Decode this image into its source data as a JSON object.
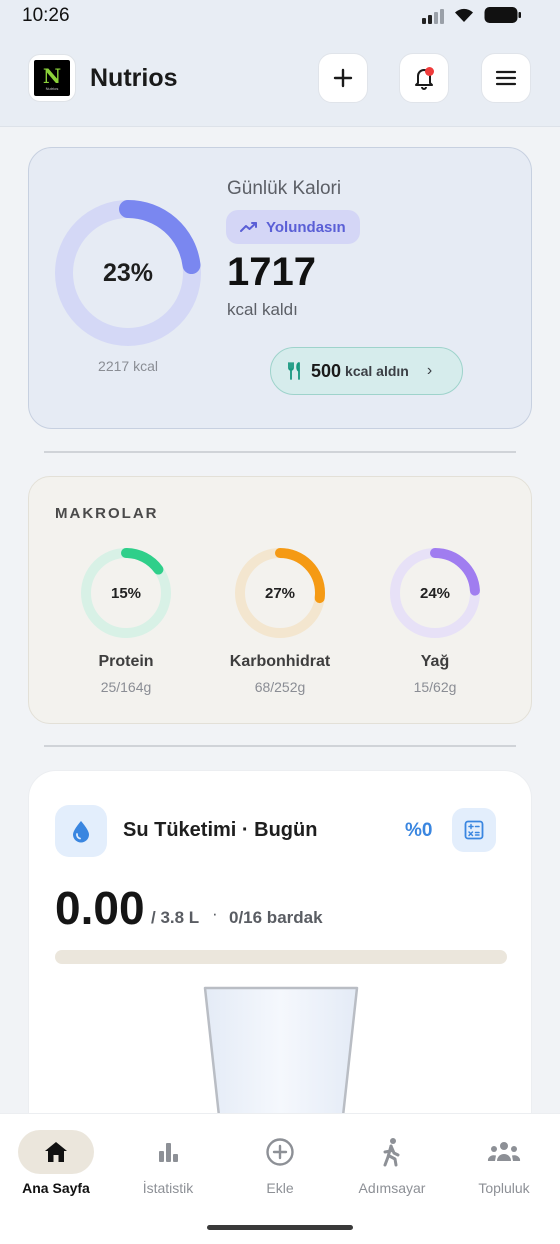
{
  "status_bar": {
    "time": "10:26"
  },
  "header": {
    "app_name": "Nutrios",
    "logo_letter": "N",
    "logo_caption": "Nutrios",
    "has_notification": true
  },
  "calorie": {
    "title": "Günlük Kalori",
    "status_badge": "Yolundasın",
    "remaining": "1717",
    "unit_label": "kcal kaldı",
    "percent_label": "23%",
    "percent": 0.23,
    "total_label": "2217 kcal",
    "eaten_value": "500",
    "eaten_label": "kcal aldın",
    "ring_color": "#7a87f0",
    "ring_track": "#d4d8f6"
  },
  "macros": {
    "title": "MAKROLAR",
    "items": [
      {
        "name": "Protein",
        "percent_label": "15%",
        "percent": 0.15,
        "value": "25/164g",
        "color": "#2fcf8a",
        "track": "#d8f1e6"
      },
      {
        "name": "Karbonhidrat",
        "percent_label": "27%",
        "percent": 0.27,
        "value": "68/252g",
        "color": "#f59a14",
        "track": "#f3e6cf"
      },
      {
        "name": "Yağ",
        "percent_label": "24%",
        "percent": 0.24,
        "value": "15/62g",
        "color": "#a07df0",
        "track": "#e7e1f7"
      }
    ]
  },
  "water": {
    "title": "Su Tüketimi · Bugün",
    "percent_label": "%0",
    "percent": 0,
    "amount": "0.00",
    "goal": "/ 3.8 L",
    "separator": "·",
    "glasses": "0/16 bardak",
    "accent": "#3a86e0"
  },
  "nav": {
    "items": [
      {
        "label": "Ana Sayfa",
        "icon": "home-icon",
        "active": true
      },
      {
        "label": "İstatistik",
        "icon": "bar-chart-icon",
        "active": false
      },
      {
        "label": "Ekle",
        "icon": "add-circle-icon",
        "active": false
      },
      {
        "label": "Adımsayar",
        "icon": "walking-icon",
        "active": false
      },
      {
        "label": "Topluluk",
        "icon": "community-icon",
        "active": false
      }
    ]
  }
}
